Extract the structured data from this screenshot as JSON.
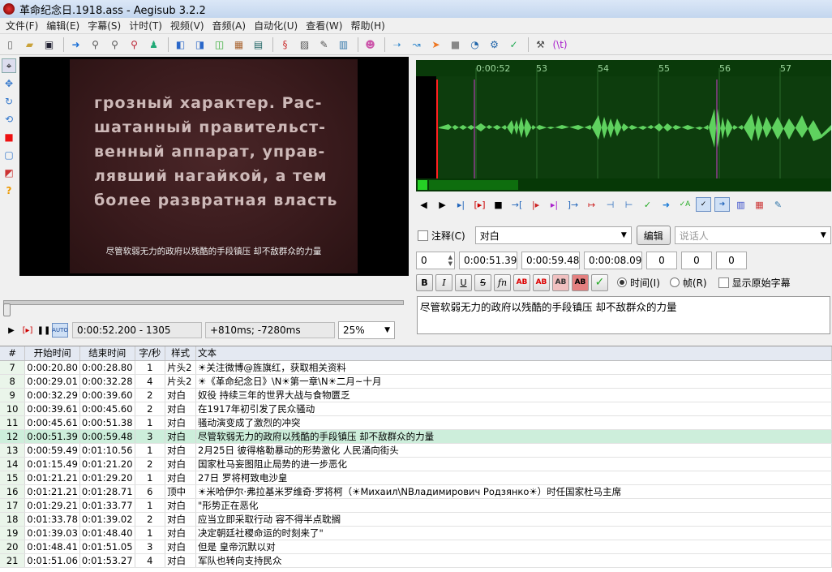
{
  "window": {
    "title": "革命纪念日.1918.ass - Aegisub 3.2.2"
  },
  "menu": [
    "文件(F)",
    "编辑(E)",
    "字幕(S)",
    "计时(T)",
    "视频(V)",
    "音频(A)",
    "自动化(U)",
    "查看(W)",
    "帮助(H)"
  ],
  "video": {
    "lines": [
      "грозный характер. Рас-",
      "шатанный правительст-",
      "венный аппарат, управ-",
      "лявший нагайкой, а тем",
      "более развратная власть"
    ],
    "subtitle": "尽管软弱无力的政府以残酷的手段镇压 却不敌群众的力量",
    "position": "0:00:52.200 - 1305",
    "offset": "+810ms; -7280ms",
    "zoom": "25%"
  },
  "audio": {
    "ticks": [
      "0:00:52",
      "53",
      "54",
      "55",
      "56",
      "57"
    ]
  },
  "editor": {
    "comment_label": "注释(C)",
    "style": "对白",
    "edit_button": "编辑",
    "actor_placeholder": "说话人",
    "layer": "0",
    "start": "0:00:51.39",
    "end": "0:00:59.48",
    "duration": "0:00:08.09",
    "margin_l": "0",
    "margin_r": "0",
    "margin_v": "0",
    "bold": "B",
    "italic": "I",
    "underline": "U",
    "strike": "S",
    "font": "fn",
    "time_label": "时间(I)",
    "frame_label": "帧(R)",
    "show_original_label": "显示原始字幕",
    "text": "尽管软弱无力的政府以残酷的手段镇压 却不敌群众的力量"
  },
  "grid": {
    "headers": [
      "#",
      "开始时间",
      "结束时间",
      "字/秒",
      "样式",
      "文本"
    ],
    "rows": [
      {
        "n": "7",
        "start": "0:00:20.80",
        "end": "0:00:28.80",
        "cps": "1",
        "style": "片头2",
        "text": "☀关注微博@旌旗红，获取相关资料"
      },
      {
        "n": "8",
        "start": "0:00:29.01",
        "end": "0:00:32.28",
        "cps": "4",
        "style": "片头2",
        "text": "☀《革命纪念日》\\N☀第一章\\N☀二月~十月"
      },
      {
        "n": "9",
        "start": "0:00:32.29",
        "end": "0:00:39.60",
        "cps": "2",
        "style": "对白",
        "text": "奴役 持续三年的世界大战与食物匮乏"
      },
      {
        "n": "10",
        "start": "0:00:39.61",
        "end": "0:00:45.60",
        "cps": "2",
        "style": "对白",
        "text": "在1917年初引发了民众骚动"
      },
      {
        "n": "11",
        "start": "0:00:45.61",
        "end": "0:00:51.38",
        "cps": "1",
        "style": "对白",
        "text": "骚动演变成了激烈的冲突"
      },
      {
        "n": "12",
        "start": "0:00:51.39",
        "end": "0:00:59.48",
        "cps": "3",
        "style": "对白",
        "text": "尽管软弱无力的政府以残酷的手段镇压 却不敌群众的力量"
      },
      {
        "n": "13",
        "start": "0:00:59.49",
        "end": "0:01:10.56",
        "cps": "1",
        "style": "对白",
        "text": "2月25日 彼得格勒暴动的形势激化 人民涌向街头"
      },
      {
        "n": "14",
        "start": "0:01:15.49",
        "end": "0:01:21.20",
        "cps": "2",
        "style": "对白",
        "text": "国家杜马妄图阻止局势的进一步恶化"
      },
      {
        "n": "15",
        "start": "0:01:21.21",
        "end": "0:01:29.20",
        "cps": "1",
        "style": "对白",
        "text": "27日 罗将柯致电沙皇"
      },
      {
        "n": "16",
        "start": "0:01:21.21",
        "end": "0:01:28.71",
        "cps": "6",
        "style": "顶中",
        "text": "☀米哈伊尔·弗拉基米罗维奇·罗将柯（☀Михаил\\NВладимирович Родзянко☀）时任国家杜马主席"
      },
      {
        "n": "17",
        "start": "0:01:29.21",
        "end": "0:01:33.77",
        "cps": "1",
        "style": "对白",
        "text": "\"形势正在恶化"
      },
      {
        "n": "18",
        "start": "0:01:33.78",
        "end": "0:01:39.02",
        "cps": "2",
        "style": "对白",
        "text": "应当立即采取行动 容不得半点耽搁"
      },
      {
        "n": "19",
        "start": "0:01:39.03",
        "end": "0:01:48.40",
        "cps": "1",
        "style": "对白",
        "text": "决定朝廷社稷命运的时刻来了\""
      },
      {
        "n": "20",
        "start": "0:01:48.41",
        "end": "0:01:51.05",
        "cps": "3",
        "style": "对白",
        "text": "但是 皇帝沉默以对"
      },
      {
        "n": "21",
        "start": "0:01:51.06",
        "end": "0:01:53.27",
        "cps": "4",
        "style": "对白",
        "text": "军队也转向支持民众"
      }
    ]
  }
}
